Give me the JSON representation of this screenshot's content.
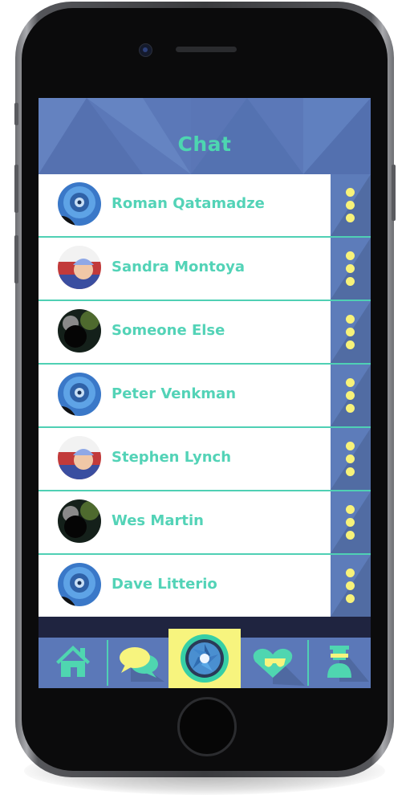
{
  "header": {
    "title": "Chat"
  },
  "contacts": [
    {
      "name": "Roman Qatamadze",
      "avatar": "blue-eye-avatar"
    },
    {
      "name": "Sandra Montoya",
      "avatar": "red-cap-avatar"
    },
    {
      "name": "Someone Else",
      "avatar": "dark-cat-avatar"
    },
    {
      "name": "Peter Venkman",
      "avatar": "blue-eye-avatar"
    },
    {
      "name": "Stephen Lynch",
      "avatar": "red-cap-avatar"
    },
    {
      "name": "Wes Martin",
      "avatar": "dark-cat-avatar"
    },
    {
      "name": "Dave Litterio",
      "avatar": "blue-eye-avatar"
    }
  ],
  "tabbar": {
    "items": [
      {
        "icon": "home-icon"
      },
      {
        "icon": "chat-bubbles-icon"
      },
      {
        "icon": "camera-aperture-icon",
        "active": true
      },
      {
        "icon": "heart-sunglasses-icon"
      },
      {
        "icon": "profile-icon"
      }
    ]
  },
  "colors": {
    "primary_blue": "#5b78b8",
    "accent_teal": "#53d3b7",
    "highlight_yellow": "#f7f47e",
    "dot_yellow": "#f7f27a"
  }
}
